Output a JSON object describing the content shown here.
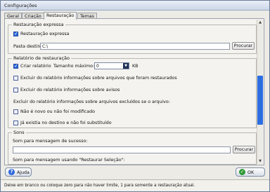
{
  "window": {
    "title": "Configurações"
  },
  "tabs": [
    {
      "label": "Geral"
    },
    {
      "label": "Criação"
    },
    {
      "label": "Restauração"
    },
    {
      "label": "Temas"
    }
  ],
  "quick_restore": {
    "legend": "Restauração expressa",
    "checkbox_label": "Restauração expressa",
    "checked": true,
    "dest_label": "Pasta destino:",
    "dest_value": "C:\\",
    "browse_label": "Procurar"
  },
  "report": {
    "legend": "Relatório de restauração",
    "create_label": "Criar relatório",
    "create_checked": true,
    "max_size_label": "Tamanho máximo:",
    "max_size_value": "0",
    "unit": "KB",
    "exclude_restored_label": "Excluir do relatório informações sobre arquivos que foram restaurados",
    "exclude_warnings_label": "Excluir do relatório informações sobre avisos",
    "exclude_header": "Excluir do relatório informações sobre arquivos excluídos se o arquivo:",
    "not_new_label": "Não é novo ou não foi modificado",
    "exists_label": "Já existia no destino e não foi substituído"
  },
  "sounds": {
    "legend": "Sons",
    "success_label": "Som para mensagem de sucesso:",
    "browse_label": "Procurar",
    "restore_msg_label": "Som para mensagem usando \"Restaurar Seleção\":"
  },
  "footer": {
    "help_label": "Ajuda",
    "ok_label": "OK"
  },
  "status": {
    "text": "Deixe em branco ou coloque zero para não haver limite, 1 para somente a restauração atual."
  }
}
